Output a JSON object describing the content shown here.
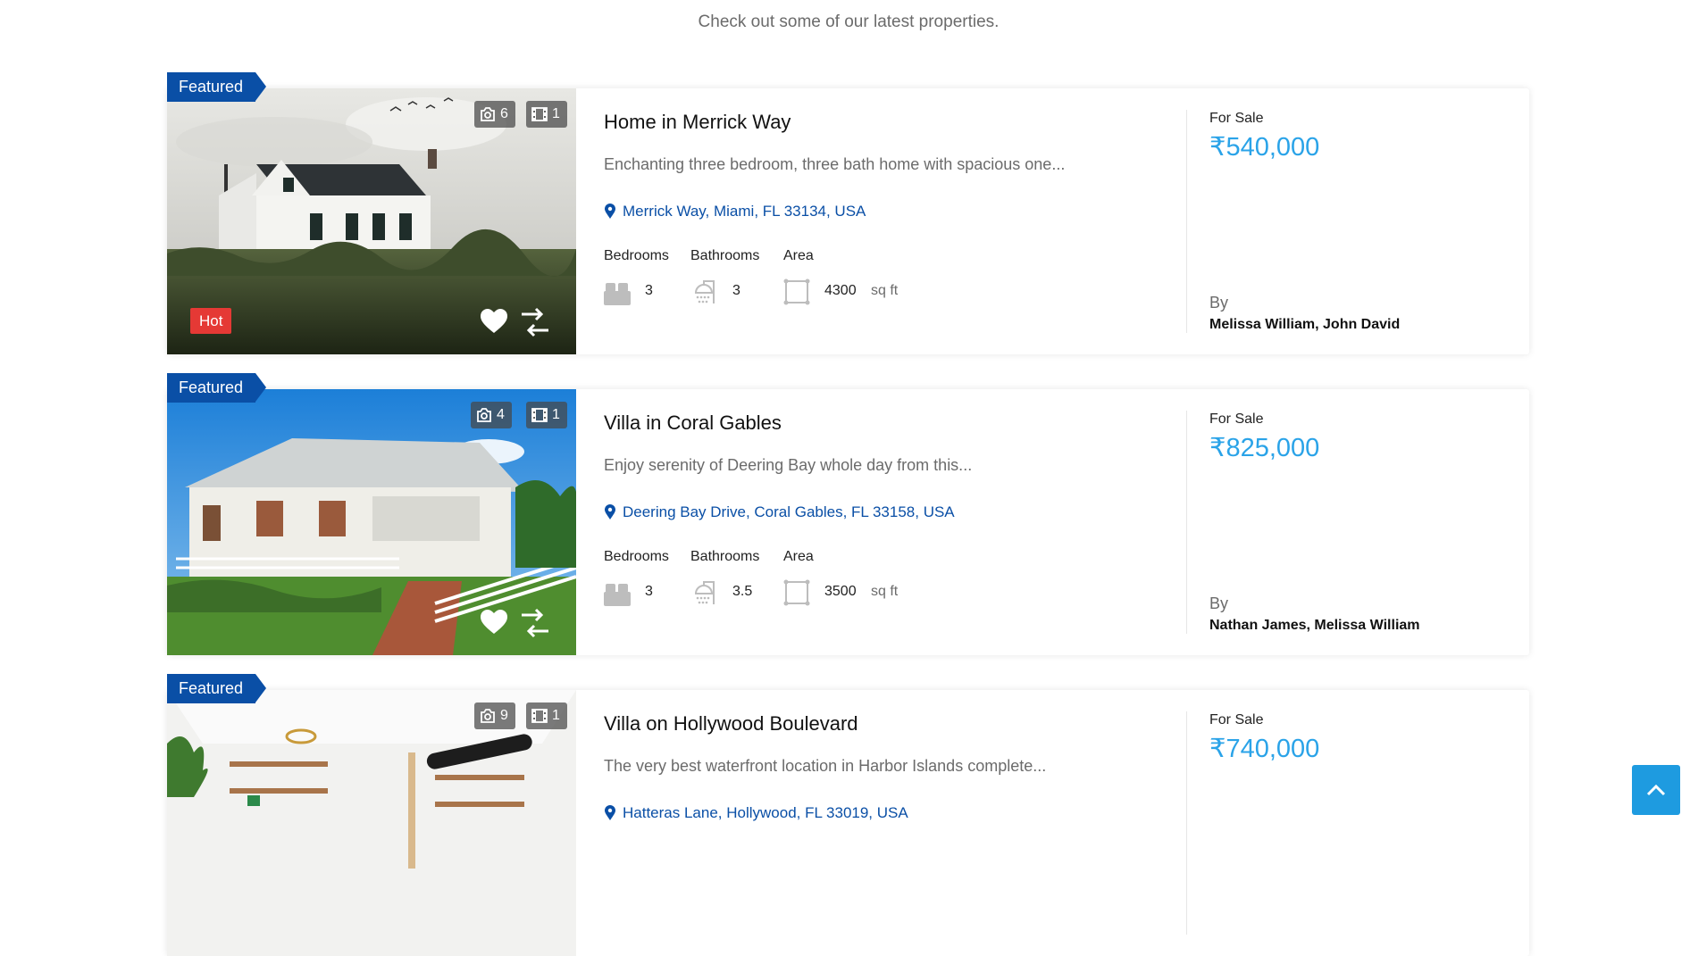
{
  "header": {
    "subtitle": "Check out some of our latest properties."
  },
  "labels": {
    "featured": "Featured",
    "hot": "Hot",
    "bedrooms": "Bedrooms",
    "bathrooms": "Bathrooms",
    "area": "Area",
    "area_unit": "sq ft",
    "by": "By"
  },
  "colors": {
    "accent": "#0a4fa6",
    "price": "#2aa3e8",
    "hot": "#e53935",
    "scroll_button": "#1e9be0"
  },
  "listings": [
    {
      "title": "Home in Merrick Way",
      "description": "Enchanting three bedroom, three bath home with spacious one...",
      "location": "Merrick Way, Miami, FL 33134, USA",
      "photo_count": "6",
      "video_count": "1",
      "hot": true,
      "bedrooms": "3",
      "bathrooms": "3",
      "area": "4300",
      "status": "For Sale",
      "price": "₹540,000",
      "agents": "Melissa William, John David"
    },
    {
      "title": "Villa in Coral Gables",
      "description": "Enjoy serenity of Deering Bay whole day from this...",
      "location": "Deering Bay Drive, Coral Gables, FL 33158, USA",
      "photo_count": "4",
      "video_count": "1",
      "hot": false,
      "bedrooms": "3",
      "bathrooms": "3.5",
      "area": "3500",
      "status": "For Sale",
      "price": "₹825,000",
      "agents": "Nathan James, Melissa William"
    },
    {
      "title": "Villa on Hollywood Boulevard",
      "description": "The very best waterfront location in Harbor Islands complete...",
      "location": "Hatteras Lane, Hollywood, FL 33019, USA",
      "photo_count": "9",
      "video_count": "1",
      "status": "For Sale",
      "price": "₹740,000"
    }
  ]
}
